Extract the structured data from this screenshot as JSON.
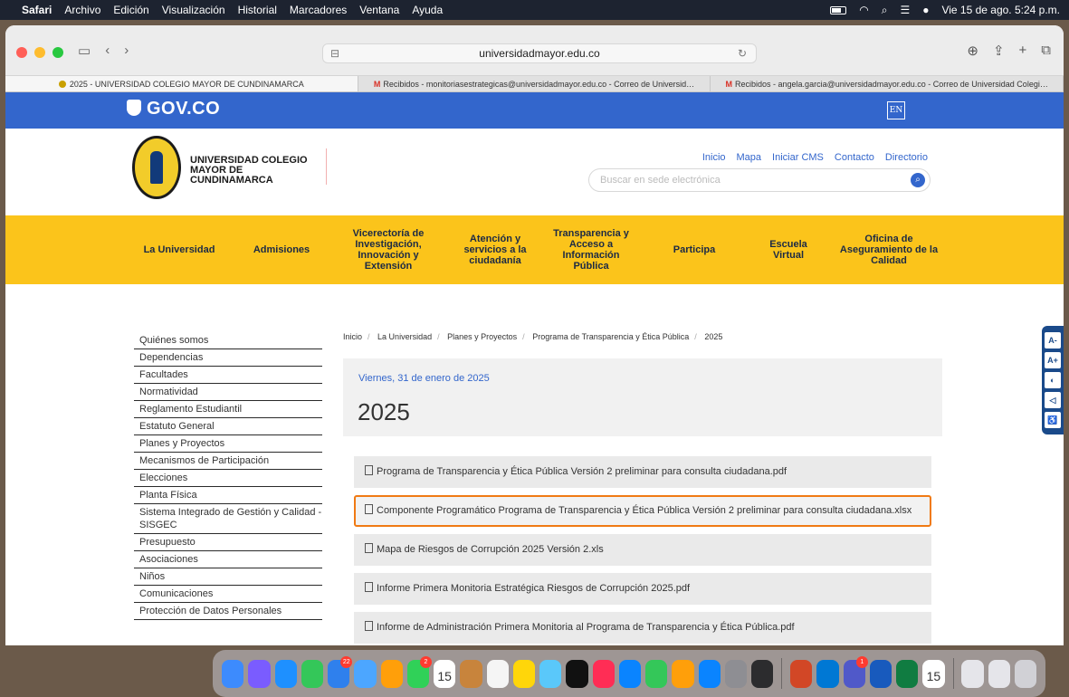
{
  "menubar": {
    "apple": "",
    "items": [
      "Safari",
      "Archivo",
      "Edición",
      "Visualización",
      "Historial",
      "Marcadores",
      "Ventana",
      "Ayuda"
    ],
    "datetime": "Vie 15 de ago.  5:24 p.m."
  },
  "browser": {
    "url": "universidadmayor.edu.co",
    "tabs": [
      "2025 - UNIVERSIDAD COLEGIO MAYOR DE CUNDINAMARCA",
      "Recibidos - monitoriasestrategicas@universidadmayor.edu.co - Correo de Universid…",
      "Recibidos - angela.garcia@universidadmayor.edu.co - Correo de Universidad Colegi…"
    ],
    "tab_gmail_icon": "M"
  },
  "gov": {
    "logo_text": "GOV.CO",
    "lang_button": "EN"
  },
  "header": {
    "university_name": "UNIVERSIDAD COLEGIO MAYOR DE CUNDINAMARCA",
    "links": [
      "Inicio",
      "Mapa",
      "Iniciar CMS",
      "Contacto",
      "Directorio"
    ],
    "search_placeholder": "Buscar en sede electrónica"
  },
  "nav": [
    "La Universidad",
    "Admisiones",
    "Vicerectoría de Investigación, Innovación y Extensión",
    "Atención y servicios a la ciudadanía",
    "Transparencia y Acceso a Información Pública",
    "Participa",
    "Escuela Virtual",
    "Oficina de Aseguramiento de la Calidad"
  ],
  "sidebar": [
    "Quiénes somos",
    "Dependencias",
    "Facultades",
    "Normatividad",
    "Reglamento Estudiantil",
    "Estatuto General",
    "Planes y Proyectos",
    "Mecanismos de Participación",
    "Elecciones",
    "Planta Física",
    "Sistema Integrado de Gestión y Calidad -SISGEC",
    "Presupuesto",
    "Asociaciones",
    "Niños",
    "Comunicaciones",
    "Protección de Datos Personales"
  ],
  "breadcrumb": [
    "Inicio",
    "La Universidad",
    "Planes y Proyectos",
    "Programa de Transparencia y Ética Pública",
    "2025"
  ],
  "article": {
    "date": "Viernes, 31 de enero de 2025",
    "title": "2025"
  },
  "documents": [
    "Programa de Transparencia y Ética Pública Versión 2 preliminar para consulta ciudadana.pdf",
    "Componente Programático Programa de Transparencia y Ética Pública Versión 2 preliminar para consulta ciudadana.xlsx",
    "Mapa de Riesgos de Corrupción 2025 Versión 2.xls",
    "Informe Primera Monitoria Estratégica Riesgos de Corrupción 2025.pdf",
    "Informe de Administración Primera Monitoria al Programa de Transparencia y Ética Pública.pdf"
  ],
  "accessibility": [
    "A-",
    "A+",
    "contrast-icon",
    "megaphone-icon",
    "wheelchair-icon"
  ],
  "dock": {
    "mail_badge": "22",
    "messages_badge": "2",
    "calendar_day": "15",
    "teams_badge": "1"
  }
}
